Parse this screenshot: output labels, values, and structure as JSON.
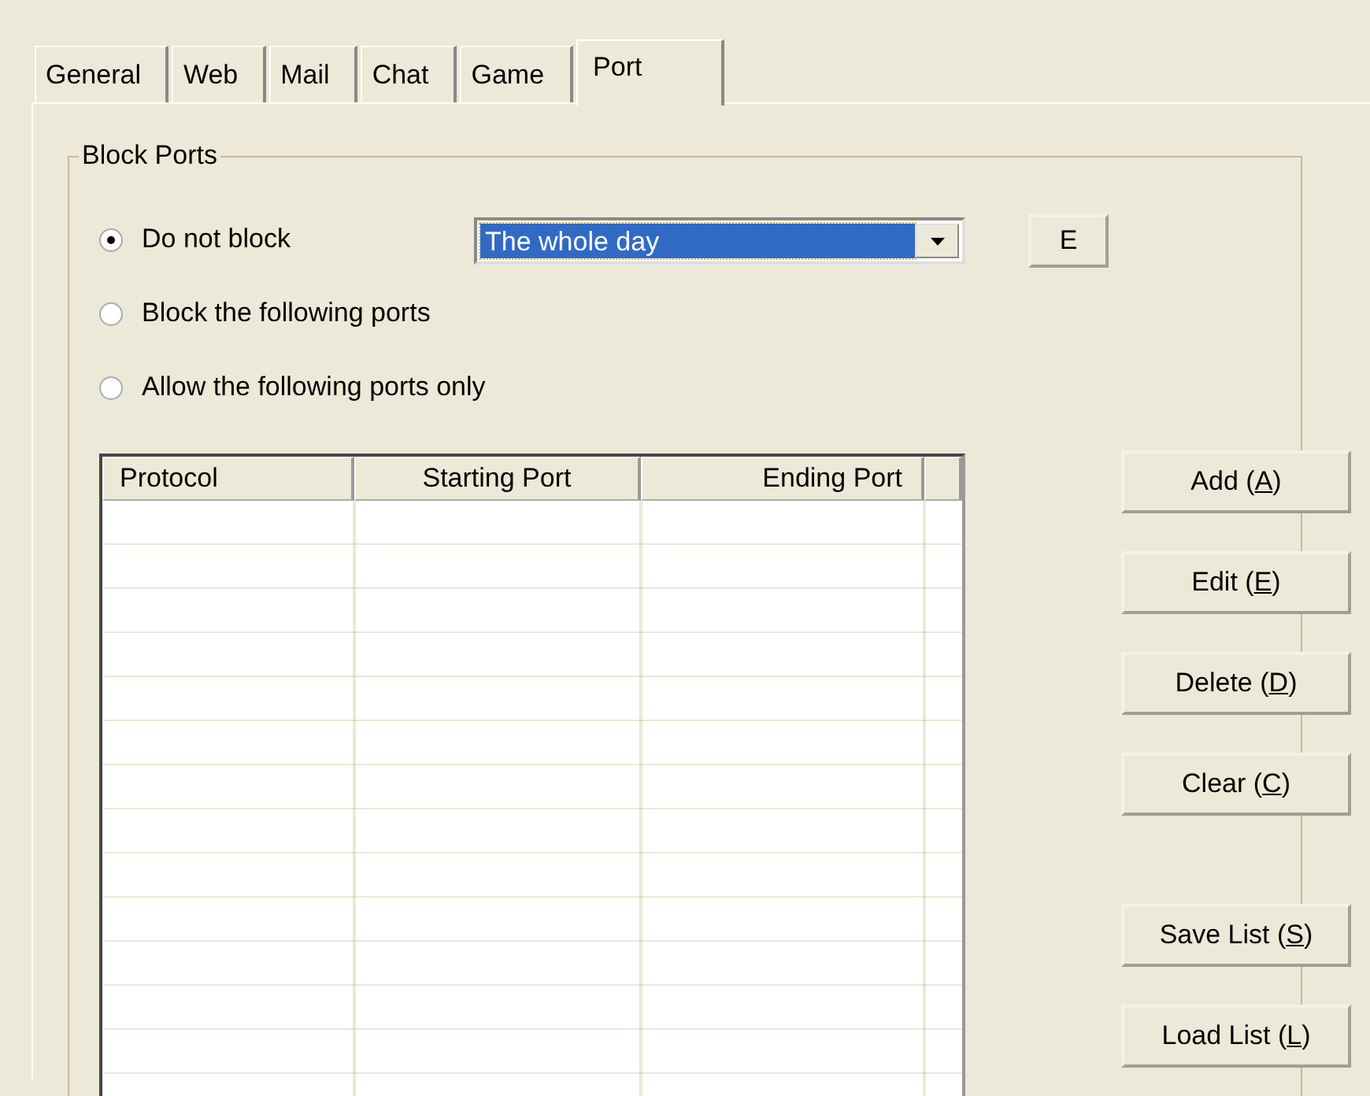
{
  "tabs": [
    {
      "label": "General",
      "selected": false
    },
    {
      "label": "Web",
      "selected": false
    },
    {
      "label": "Mail",
      "selected": false
    },
    {
      "label": "Chat",
      "selected": false
    },
    {
      "label": "Game",
      "selected": false
    },
    {
      "label": "Port",
      "selected": true
    }
  ],
  "group": {
    "title": "Block Ports"
  },
  "options": [
    {
      "label": "Do not block",
      "selected": true
    },
    {
      "label": "Block the following ports",
      "selected": false
    },
    {
      "label": "Allow the following ports only",
      "selected": false
    }
  ],
  "schedule": {
    "value": "The whole day"
  },
  "edit_schedule_button": "E",
  "table": {
    "columns": [
      "Protocol",
      "Starting Port",
      "Ending Port"
    ]
  },
  "list_buttons": [
    {
      "before": "Add (",
      "mnemonic": "A",
      "after": ")"
    },
    {
      "before": "Edit (",
      "mnemonic": "E",
      "after": ")"
    },
    {
      "before": "Delete (",
      "mnemonic": "D",
      "after": ")"
    },
    {
      "before": "Clear (",
      "mnemonic": "C",
      "after": ")"
    }
  ],
  "file_buttons": [
    {
      "before": "Save List (",
      "mnemonic": "S",
      "after": ")"
    },
    {
      "before": "Load List (",
      "mnemonic": "L",
      "after": ")"
    }
  ]
}
